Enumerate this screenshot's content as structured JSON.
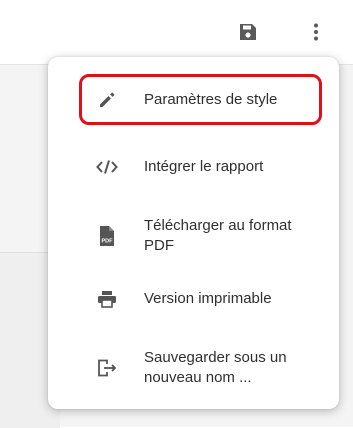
{
  "toolbar": {
    "save_icon": "floppy-disk-icon",
    "more_icon": "vertical-ellipsis-icon"
  },
  "menu": {
    "items": [
      {
        "label": "Paramètres de style",
        "icon": "pencil-icon",
        "highlighted": true
      },
      {
        "label": "Intégrer le rapport",
        "icon": "code-brackets-icon"
      },
      {
        "label": "Télécharger au format PDF",
        "icon": "pdf-file-icon"
      },
      {
        "label": "Version imprimable",
        "icon": "printer-icon"
      },
      {
        "label": "Sauvegarder sous un nouveau nom ...",
        "icon": "file-export-icon"
      }
    ]
  },
  "colors": {
    "highlight": "#e0101a",
    "icon": "#555555"
  }
}
